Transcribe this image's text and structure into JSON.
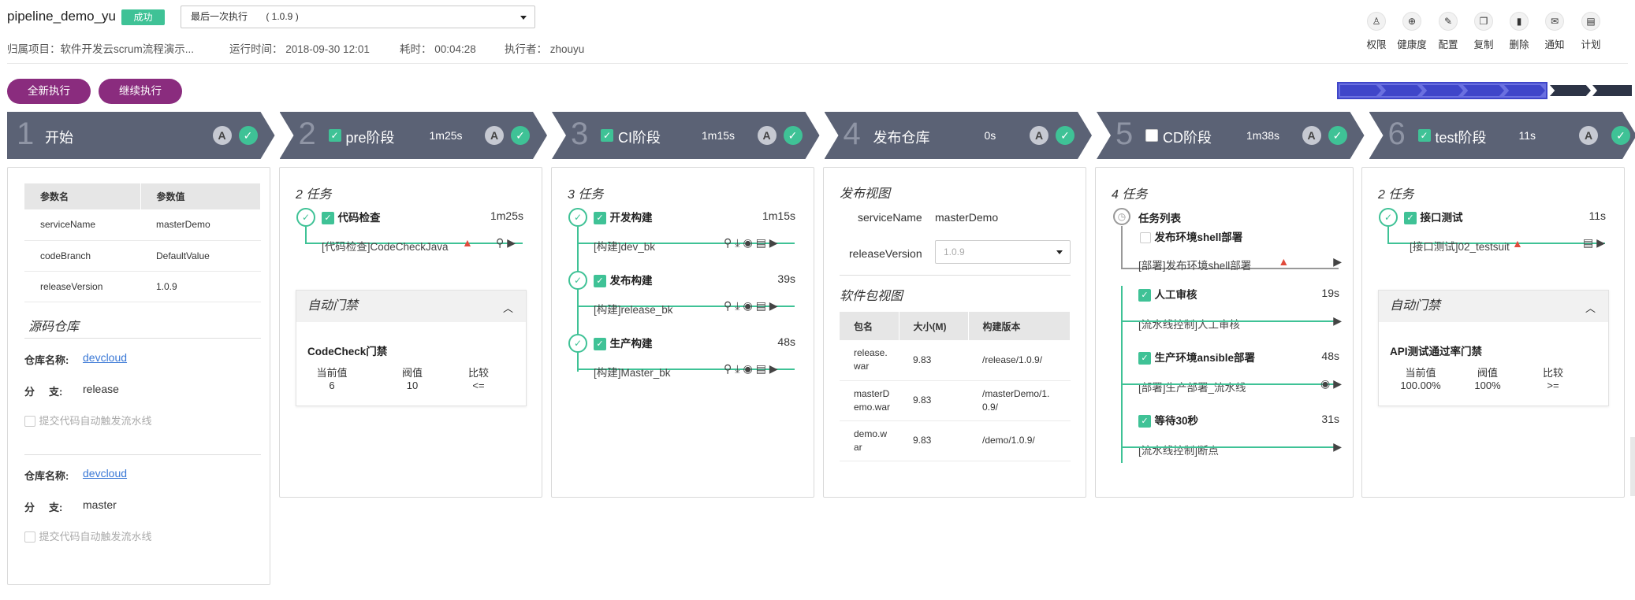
{
  "header": {
    "pipeline_name": "pipeline_demo_yu",
    "status": "成功",
    "run_select": "最后一次执行       ( 1.0.9 )",
    "project": "归属项目：软件开发云scrum流程演示...",
    "run_time": "运行时间： 2018-09-30 12:01",
    "duration": "耗时： 00:04:28",
    "executor": "执行者： zhouyu"
  },
  "toolbar": [
    {
      "label": "权限",
      "icon": "permission-icon",
      "glyph": "♙"
    },
    {
      "label": "健康度",
      "icon": "health-icon",
      "glyph": "⊕"
    },
    {
      "label": "配置",
      "icon": "pencil-icon",
      "glyph": "✎"
    },
    {
      "label": "复制",
      "icon": "copy-icon",
      "glyph": "❐"
    },
    {
      "label": "删除",
      "icon": "trash-icon",
      "glyph": "▮"
    },
    {
      "label": "通知",
      "icon": "mail-icon",
      "glyph": "✉"
    },
    {
      "label": "计划",
      "icon": "schedule-icon",
      "glyph": "▤"
    }
  ],
  "actions": {
    "rerun_all": "全新执行",
    "resume": "继续执行"
  },
  "colors": {
    "accent": "#8a2c7e",
    "success": "#3fc296",
    "stage_bg": "#5b6275",
    "warn": "#e04b3c",
    "link": "#3a78d6"
  },
  "stages": [
    {
      "num": "1",
      "name": "开始",
      "time": "",
      "checkbox": "none"
    },
    {
      "num": "2",
      "name": "pre阶段",
      "time": "1m25s",
      "checkbox": "on"
    },
    {
      "num": "3",
      "name": "CI阶段",
      "time": "1m15s",
      "checkbox": "on"
    },
    {
      "num": "4",
      "name": "发布仓库",
      "time": "0s",
      "checkbox": "none"
    },
    {
      "num": "5",
      "name": "CD阶段",
      "time": "1m38s",
      "checkbox": "off"
    },
    {
      "num": "6",
      "name": "test阶段",
      "time": "11s",
      "checkbox": "on"
    }
  ],
  "stage_a": "A",
  "params": {
    "headers": [
      "参数名",
      "参数值"
    ],
    "rows": [
      [
        "serviceName",
        "masterDemo"
      ],
      [
        "codeBranch",
        "DefaultValue"
      ],
      [
        "releaseVersion",
        "1.0.9"
      ]
    ],
    "repo_title": "源码仓库",
    "repos": [
      {
        "name_label": "仓库名称:",
        "name": "devcloud",
        "branch_label": "分     支:",
        "branch": "release",
        "auto_trigger": "提交代码自动触发流水线"
      },
      {
        "name_label": "仓库名称:",
        "name": "devcloud",
        "branch_label": "分     支:",
        "branch": "master",
        "auto_trigger": "提交代码自动触发流水线"
      }
    ]
  },
  "pre": {
    "task_count": "2 任务",
    "task": {
      "name": "代码检查",
      "time": "1m25s",
      "sub": "[代码检查]CodeCheckJava"
    },
    "gate": {
      "title": "自动门禁",
      "name": "CodeCheck门禁",
      "cols": [
        "当前值",
        "阀值",
        "比较"
      ],
      "vals": [
        "6",
        "10",
        "<="
      ]
    }
  },
  "ci": {
    "task_count": "3 任务",
    "tasks": [
      {
        "name": "开发构建",
        "time": "1m15s",
        "sub": "[构建]dev_bk"
      },
      {
        "name": "发布构建",
        "time": "39s",
        "sub": "[构建]release_bk"
      },
      {
        "name": "生产构建",
        "time": "48s",
        "sub": "[构建]Master_bk"
      }
    ]
  },
  "release": {
    "view_title": "发布视图",
    "service_label": "serviceName",
    "service_value": "masterDemo",
    "version_label": "releaseVersion",
    "version_value": "1.0.9",
    "pkg_title": "软件包视图",
    "headers": [
      "包名",
      "大小(M)",
      "构建版本"
    ],
    "rows": [
      [
        "release.\nwar",
        "9.83",
        "/release/1.0.9/"
      ],
      [
        "masterD\nemo.war",
        "9.83",
        "/masterDemo/1.\n0.9/"
      ],
      [
        "demo.w\nar",
        "9.83",
        "/demo/1.0.9/"
      ]
    ]
  },
  "cd": {
    "task_count": "4 任务",
    "list_title": "任务列表",
    "tasks": [
      {
        "name": "发布环境shell部署",
        "time": "",
        "sub": "[部署]发布环境shell部署",
        "checked": false
      },
      {
        "name": "人工审核",
        "time": "19s",
        "sub": "[流水线控制]人工审核",
        "checked": true
      },
      {
        "name": "生产环境ansible部署",
        "time": "48s",
        "sub": "[部署]生产部署_流水线",
        "checked": true
      },
      {
        "name": "等待30秒",
        "time": "31s",
        "sub": "[流水线控制]断点",
        "checked": true
      }
    ]
  },
  "test": {
    "task_count": "2 任务",
    "task": {
      "name": "接口测试",
      "time": "11s",
      "sub": "[接口测试]02_testsuit"
    },
    "gate": {
      "title": "自动门禁",
      "name": "API测试通过率门禁",
      "cols": [
        "当前值",
        "阀值",
        "比较"
      ],
      "vals": [
        "100.00%",
        "100%",
        ">="
      ]
    }
  }
}
